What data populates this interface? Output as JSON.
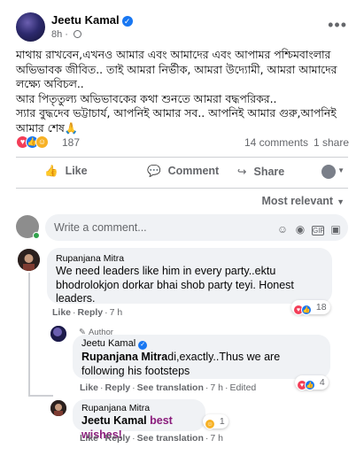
{
  "post": {
    "author": "Jeetu Kamal",
    "time": "8h",
    "more": "•••",
    "body_lines": [
      "মাথায় রাখবেন,এখনও আমার এবং আমাদের এবং আপামর পশ্চিমবাংলার",
      "অভিভাবক জীবিত.. তাই আমরা নির্ভীক, আমরা উদ্যোমী, আমরা আমাদের",
      "লক্ষ্যে অবিচল..",
      "আর পিতৃতুল্য অভিভাবকের কথা শুনতে আমরা বদ্ধপরিকর..",
      "স্যার বুদ্ধদেব ভট্টাচার্য, আপনিই আমার সব.. আপনিই আমার গুরু,আপনিই",
      "আমার শেষ🙏"
    ],
    "reaction_count": "187",
    "comments_count": "14 comments",
    "shares_count": "1 share"
  },
  "actions": {
    "like": "Like",
    "comment": "Comment",
    "share": "Share"
  },
  "sort": {
    "label": "Most relevant"
  },
  "composer": {
    "placeholder": "Write a comment..."
  },
  "comments": [
    {
      "name": "Rupanjana Mitra",
      "text": "We need leaders like him in every party..ektu bhodrolokjon dorkar bhai shob party teyi. Honest leaders.",
      "like": "Like",
      "reply": "Reply",
      "time": "7 h",
      "reaction_count": "18"
    },
    {
      "badge": "Author",
      "name": "Jeetu Kamal",
      "mention": "Rupanjana Mitra",
      "text_after": "di,exactly..Thus we are following his footsteps",
      "like": "Like",
      "reply": "Reply",
      "translation": "See translation",
      "time": "7 h",
      "edited": "Edited",
      "reaction_count": "4"
    },
    {
      "name": "Rupanjana Mitra",
      "mention": "Jeetu Kamal",
      "text_after": "best wishes!",
      "like": "Like",
      "reply": "Reply",
      "translation": "See translation",
      "time": "7 h",
      "reaction_count": "1"
    }
  ],
  "colors": {
    "accent_blue": "#1877f2",
    "bubble_bg": "#f0f2f5",
    "secondary_text": "#65676b",
    "mention_best_wishes": "#8a1c7c"
  },
  "icons": [
    "verified-badge-icon",
    "globe-icon",
    "like-icon",
    "comment-icon",
    "share-icon",
    "emoji-icon",
    "camera-icon",
    "gif-icon",
    "sticker-icon"
  ]
}
